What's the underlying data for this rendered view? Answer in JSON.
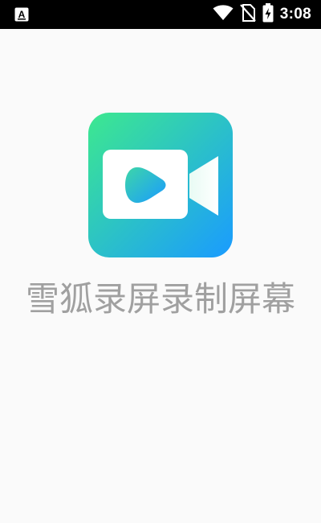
{
  "status_bar": {
    "time": "3:08",
    "notification_icon": "text-a-icon",
    "wifi_icon": "wifi-icon",
    "signal_icon": "no-sim-icon",
    "battery_icon": "battery-charging-icon"
  },
  "splash": {
    "app_icon": "video-camera-icon",
    "app_name": "雪狐录屏录制屏幕",
    "colors": {
      "icon_gradient_start": "#3de88f",
      "icon_gradient_end": "#1a9bff",
      "play_gradient_start": "#3dd6a8",
      "play_gradient_end": "#1a9bff",
      "title_color": "#a0a0a0",
      "background": "#fafafa"
    }
  }
}
